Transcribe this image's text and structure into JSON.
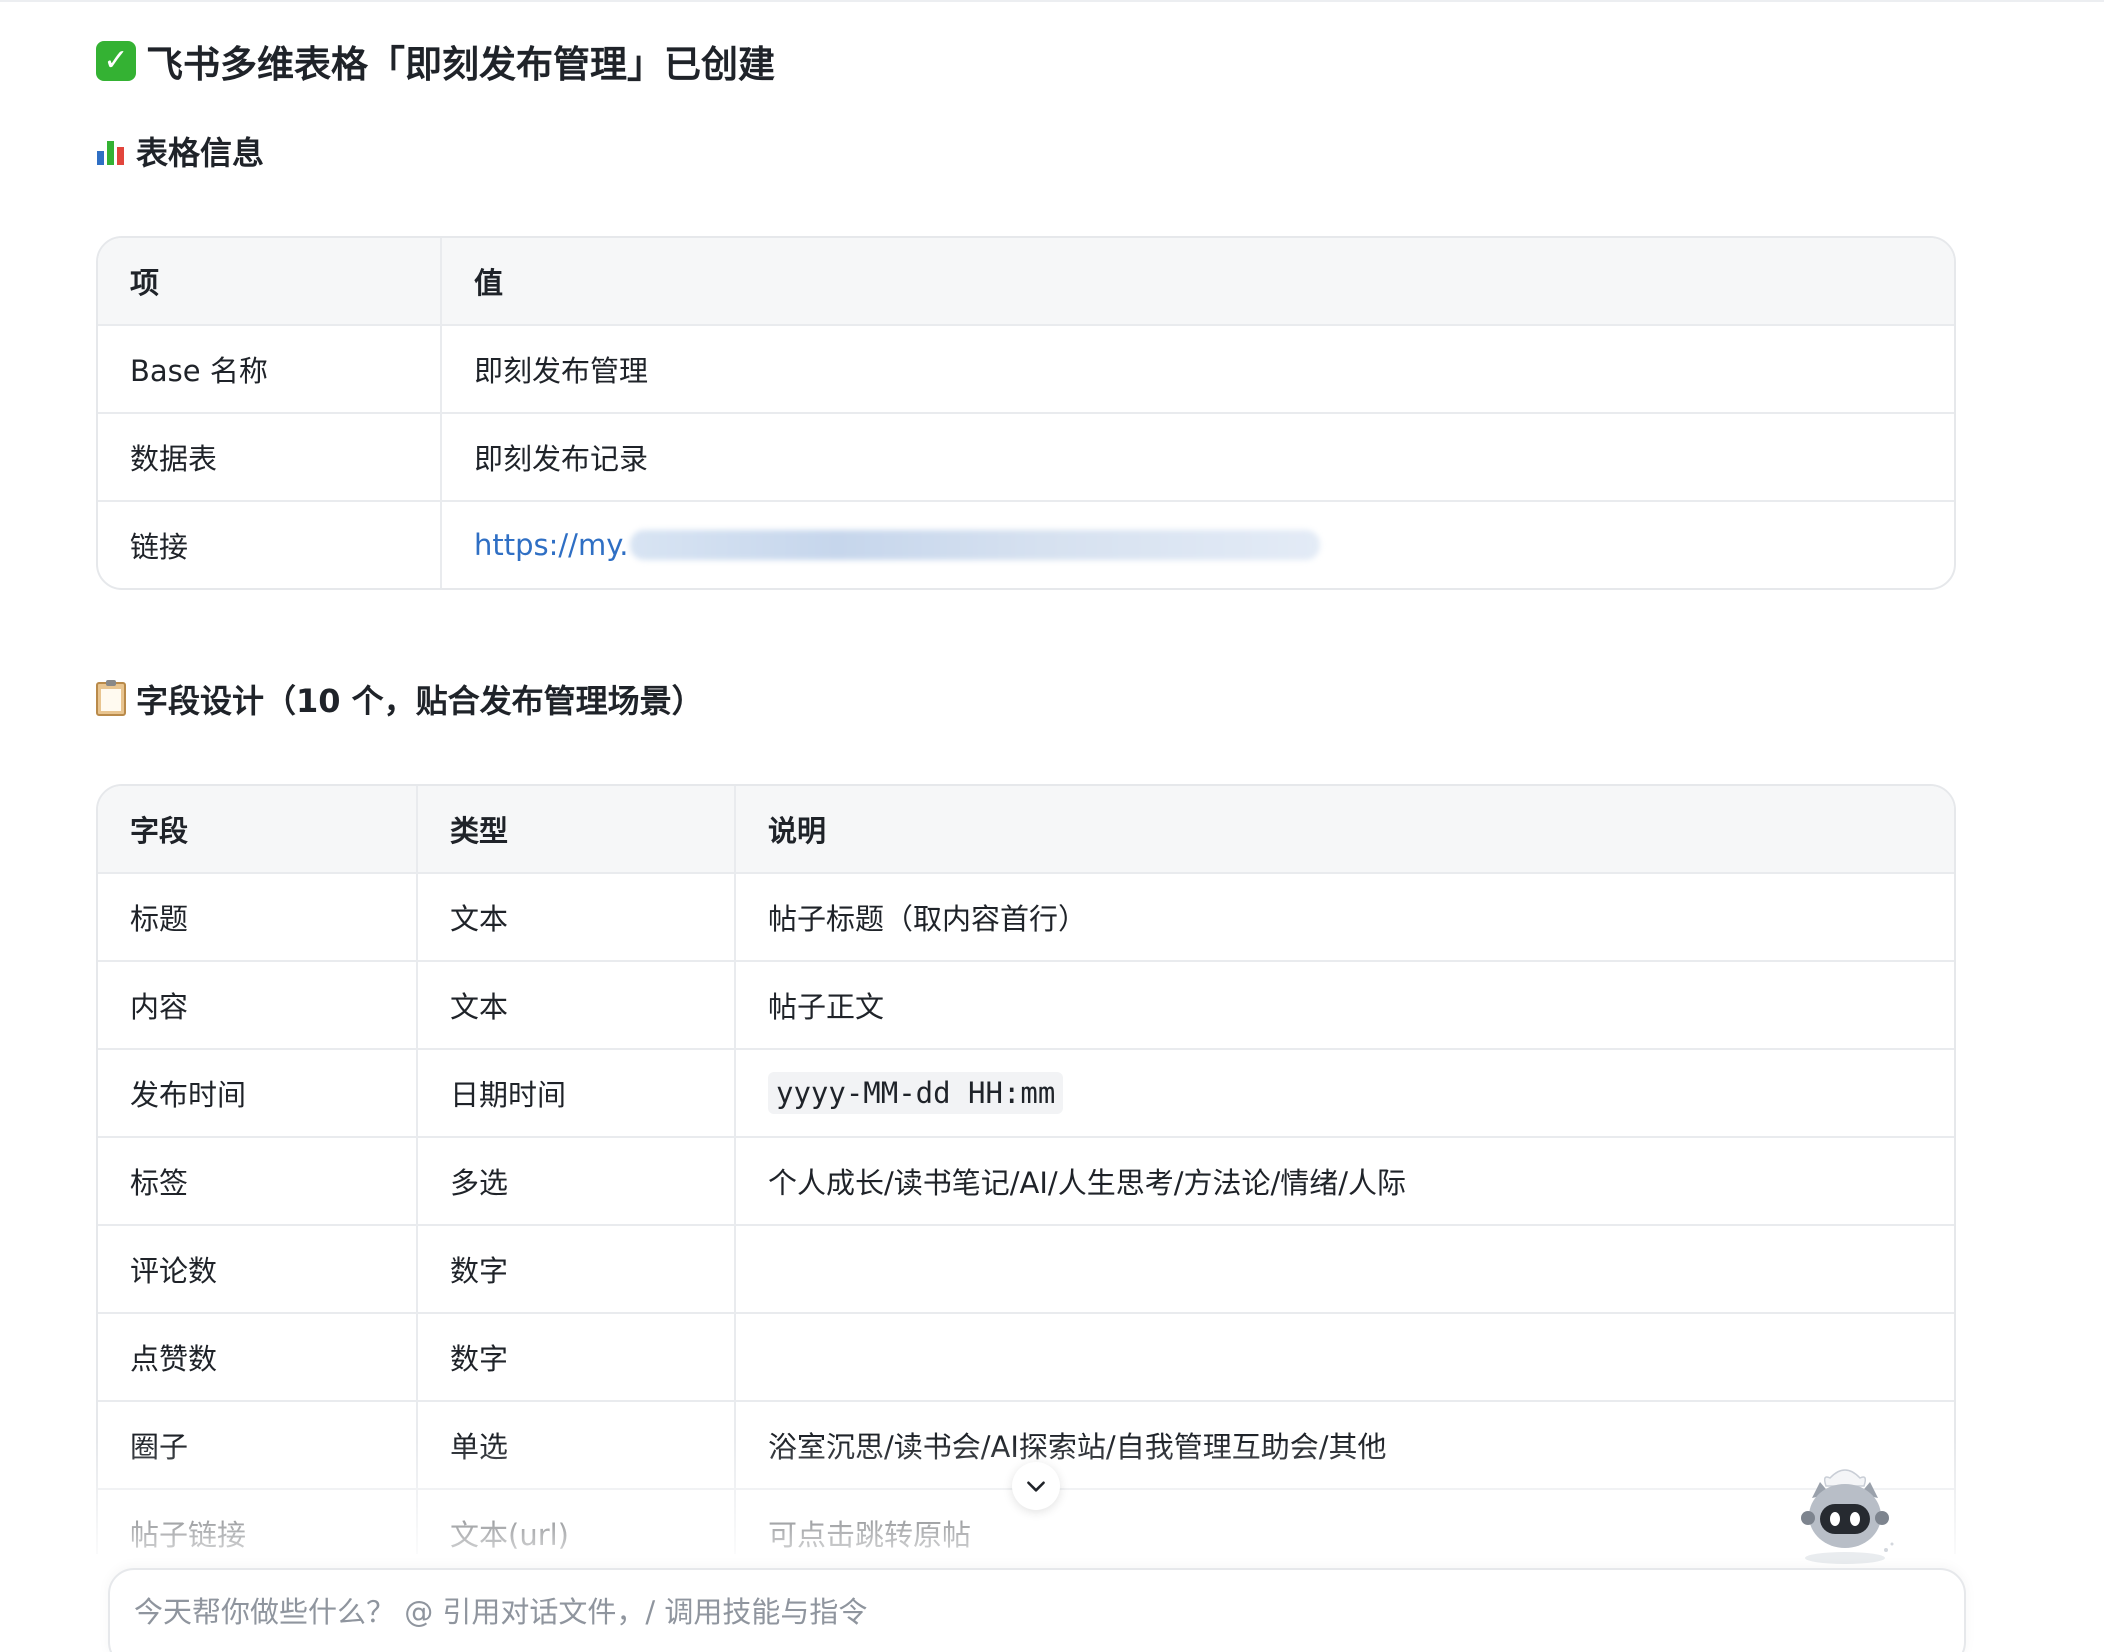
{
  "heading": "飞书多维表格「即刻发布管理」已创建",
  "info_section": {
    "title": "表格信息",
    "headers": [
      "项",
      "值"
    ],
    "rows": [
      {
        "key": "Base 名称",
        "value": "即刻发布管理"
      },
      {
        "key": "数据表",
        "value": "即刻发布记录"
      },
      {
        "key": "链接",
        "value": "https://my."
      }
    ]
  },
  "field_section": {
    "title": "字段设计（10 个，贴合发布管理场景）",
    "headers": [
      "字段",
      "类型",
      "说明"
    ],
    "rows": [
      {
        "field": "标题",
        "type": "文本",
        "desc": "帖子标题（取内容首行）"
      },
      {
        "field": "内容",
        "type": "文本",
        "desc": "帖子正文"
      },
      {
        "field": "发布时间",
        "type": "日期时间",
        "desc": "yyyy-MM-dd HH:mm"
      },
      {
        "field": "标签",
        "type": "多选",
        "desc": "个人成长/读书笔记/AI/人生思考/方法论/情绪/人际"
      },
      {
        "field": "评论数",
        "type": "数字",
        "desc": ""
      },
      {
        "field": "点赞数",
        "type": "数字",
        "desc": ""
      },
      {
        "field": "圈子",
        "type": "单选",
        "desc": "浴室沉思/读书会/AI探索站/自我管理互助会/其他"
      },
      {
        "field": "帖子链接",
        "type": "文本(url)",
        "desc": "可点击跳转原帖"
      }
    ]
  },
  "input": {
    "placeholder": "今天帮你做些什么？ @ 引用对话文件，/ 调用技能与指令"
  },
  "colors": {
    "link": "#2f6fc4",
    "check": "#34b233"
  }
}
